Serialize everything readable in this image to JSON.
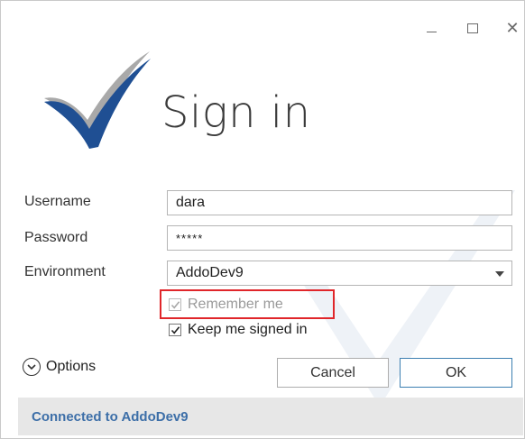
{
  "window": {
    "title": "Sign in",
    "controls": [
      "minimize",
      "maximize",
      "close"
    ]
  },
  "form": {
    "username": {
      "label": "Username",
      "value": "dara"
    },
    "password": {
      "label": "Password",
      "value": "*****"
    },
    "environment": {
      "label": "Environment",
      "value": "AddoDev9"
    }
  },
  "checkboxes": {
    "remember_me": {
      "label": "Remember me",
      "checked": true,
      "disabled": true
    },
    "keep_signed_in": {
      "label": "Keep me signed in",
      "checked": true,
      "disabled": false
    }
  },
  "options": {
    "label": "Options"
  },
  "buttons": {
    "cancel": "Cancel",
    "ok": "OK"
  },
  "status": {
    "text": "Connected to AddoDev9"
  },
  "colors": {
    "brand_dark": "#1f4f93",
    "brand_gray": "#a9a9a9",
    "highlight": "#e0262a",
    "status_text": "#3d6fa8",
    "ok_border": "#3c7fb1"
  },
  "icons": {
    "logo": "checkmark-logo-icon",
    "options": "chevron-down-circle-icon"
  }
}
